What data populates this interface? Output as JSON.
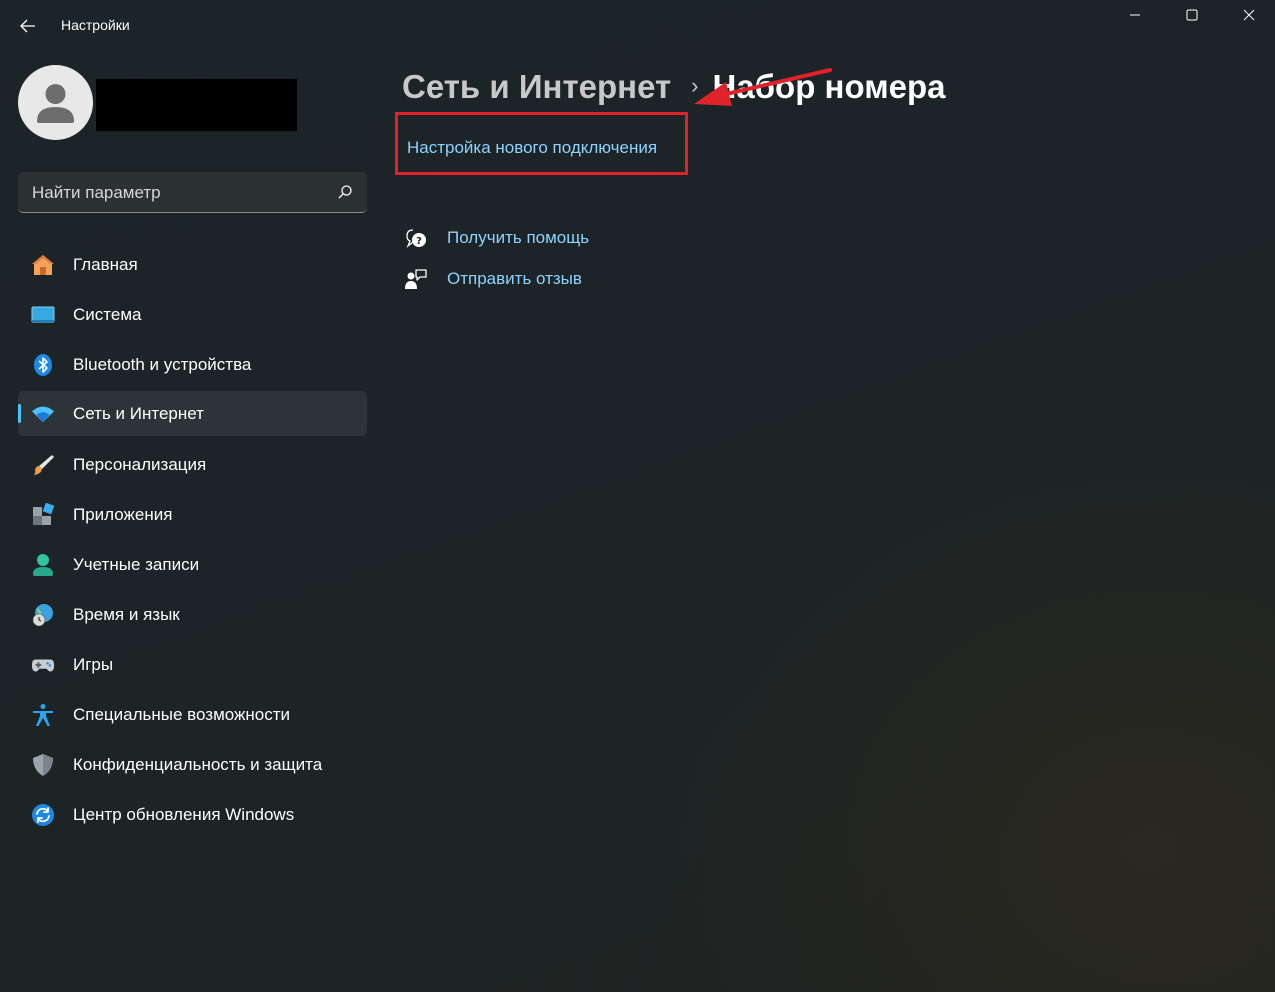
{
  "window": {
    "title": "Настройки",
    "controls": {
      "minimize": "minimize-icon",
      "maximize": "maximize-icon",
      "close": "close-icon"
    }
  },
  "profile": {
    "avatar_icon": "user-avatar-icon",
    "name_redacted": true
  },
  "search": {
    "placeholder": "Найти параметр",
    "icon": "search-icon"
  },
  "sidebar": {
    "items": [
      {
        "label": "Главная",
        "icon": "home-icon",
        "active": false
      },
      {
        "label": "Система",
        "icon": "monitor-icon",
        "active": false
      },
      {
        "label": "Bluetooth и устройства",
        "icon": "bluetooth-icon",
        "active": false
      },
      {
        "label": "Сеть и Интернет",
        "icon": "wifi-icon",
        "active": true
      },
      {
        "label": "Персонализация",
        "icon": "brush-icon",
        "active": false
      },
      {
        "label": "Приложения",
        "icon": "apps-icon",
        "active": false
      },
      {
        "label": "Учетные записи",
        "icon": "account-icon",
        "active": false
      },
      {
        "label": "Время и язык",
        "icon": "globe-clock-icon",
        "active": false
      },
      {
        "label": "Игры",
        "icon": "gamepad-icon",
        "active": false
      },
      {
        "label": "Специальные возможности",
        "icon": "accessibility-icon",
        "active": false
      },
      {
        "label": "Конфиденциальность и защита",
        "icon": "shield-icon",
        "active": false
      },
      {
        "label": "Центр обновления Windows",
        "icon": "update-icon",
        "active": false
      }
    ]
  },
  "main": {
    "breadcrumb": {
      "parent": "Сеть и Интернет",
      "separator": "›",
      "current": "Набор номера"
    },
    "new_connection_link": "Настройка нового подключения",
    "help_links": [
      {
        "label": "Получить помощь",
        "icon": "help-chat-icon"
      },
      {
        "label": "Отправить отзыв",
        "icon": "feedback-icon"
      }
    ]
  },
  "annotation": {
    "box_color": "#e0222b",
    "arrow_color": "#e0222b"
  },
  "colors": {
    "accent": "#4cc2ff",
    "link": "#8ed3ff"
  }
}
